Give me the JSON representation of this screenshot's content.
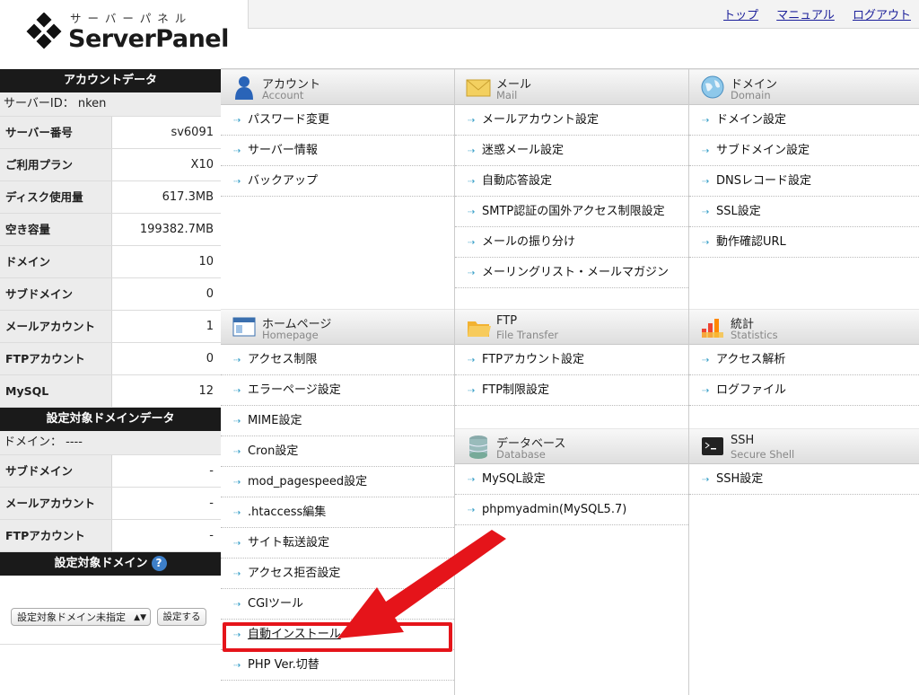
{
  "header": {
    "logo_kana": "サーバーパネル",
    "logo_name": "ServerPanel",
    "links": [
      "トップ",
      "マニュアル",
      "ログアウト"
    ]
  },
  "sidebar": {
    "account_title": "アカウントデータ",
    "server_id": "サーバーID： nken",
    "account_rows": [
      {
        "label": "サーバー番号",
        "value": "sv6091"
      },
      {
        "label": "ご利用プラン",
        "value": "X10"
      },
      {
        "label": "ディスク使用量",
        "value": "617.3MB"
      },
      {
        "label": "空き容量",
        "value": "199382.7MB"
      },
      {
        "label": "ドメイン",
        "value": "10"
      },
      {
        "label": "サブドメイン",
        "value": "0"
      },
      {
        "label": "メールアカウント",
        "value": "1"
      },
      {
        "label": "FTPアカウント",
        "value": "0"
      },
      {
        "label": "MySQL",
        "value": "12"
      }
    ],
    "domain_data_title": "設定対象ドメインデータ",
    "domain_line": "ドメイン： ----",
    "domain_rows": [
      {
        "label": "サブドメイン",
        "value": "-"
      },
      {
        "label": "メールアカウント",
        "value": "-"
      },
      {
        "label": "FTPアカウント",
        "value": "-"
      }
    ],
    "target_domain_title": "設定対象ドメイン",
    "help_icon": "?",
    "select_value": "設定対象ドメイン未指定",
    "set_button": "設定する"
  },
  "categories": {
    "account": {
      "jp": "アカウント",
      "en": "Account",
      "icon": "person-icon",
      "items": [
        "パスワード変更",
        "サーバー情報",
        "バックアップ"
      ]
    },
    "mail": {
      "jp": "メール",
      "en": "Mail",
      "icon": "envelope-icon",
      "items": [
        "メールアカウント設定",
        "迷惑メール設定",
        "自動応答設定",
        "SMTP認証の国外アクセス制限設定",
        "メールの振り分け",
        "メーリングリスト・メールマガジン"
      ]
    },
    "domain": {
      "jp": "ドメイン",
      "en": "Domain",
      "icon": "globe-icon",
      "items": [
        "ドメイン設定",
        "サブドメイン設定",
        "DNSレコード設定",
        "SSL設定",
        "動作確認URL"
      ]
    },
    "homepage": {
      "jp": "ホームページ",
      "en": "Homepage",
      "icon": "window-icon",
      "items": [
        "アクセス制限",
        "エラーページ設定",
        "MIME設定",
        "Cron設定",
        "mod_pagespeed設定",
        ".htaccess編集",
        "サイト転送設定",
        "アクセス拒否設定",
        "CGIツール",
        "自動インストール",
        "PHP Ver.切替"
      ]
    },
    "ftp": {
      "jp": "FTP",
      "en": "File Transfer",
      "icon": "folder-icon",
      "items": [
        "FTPアカウント設定",
        "FTP制限設定"
      ]
    },
    "stats": {
      "jp": "統計",
      "en": "Statistics",
      "icon": "chart-icon",
      "items": [
        "アクセス解析",
        "ログファイル"
      ]
    },
    "database": {
      "jp": "データベース",
      "en": "Database",
      "icon": "database-icon",
      "items": [
        "MySQL設定",
        "phpmyadmin(MySQL5.7)"
      ]
    },
    "ssh": {
      "jp": "SSH",
      "en": "Secure Shell",
      "icon": "terminal-icon",
      "items": [
        "SSH設定"
      ]
    }
  },
  "colors": {
    "highlight": "#e5141a",
    "link": "#1b1f9a",
    "sidebar_head": "#1a1a1a"
  }
}
